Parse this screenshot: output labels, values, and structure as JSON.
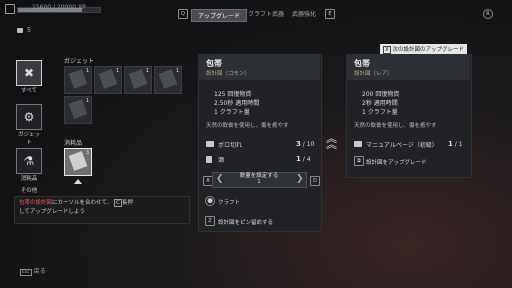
{
  "header": {
    "xp_text": "15600 / 20000 XP",
    "xp_progress": 0.78,
    "resource_count": "5",
    "tabs": [
      {
        "key": "Q",
        "label": "アップグレード"
      },
      {
        "label": "クラフト武器"
      },
      {
        "label": "武器強化"
      }
    ],
    "right_key": "E",
    "corner_btn": "R"
  },
  "nav": {
    "items": [
      {
        "label": "すべて",
        "icon": "crossed-tools-icon"
      },
      {
        "label": "ガジェット",
        "icon": "gadget-icon"
      },
      {
        "label": "消耗品",
        "icon": "bottle-icon"
      },
      {
        "label": "その他",
        "icon": "misc-icon"
      }
    ]
  },
  "inventory": {
    "gadget_title": "ガジェット",
    "gadget_slots": [
      {
        "count": "1"
      },
      {
        "count": "1"
      },
      {
        "count": "1"
      },
      {
        "count": "1"
      },
      {
        "count": "1"
      }
    ],
    "consumable_title": "消耗品",
    "consumable_slots": [
      {
        "count": "3"
      }
    ]
  },
  "tooltip": {
    "line1_red": "包帯の設計図",
    "line1_rest": "にカーソルを合わせて、",
    "key": "C",
    "line1_end": "長押",
    "line2": "してアップグレードしよう"
  },
  "back": {
    "key": "Esc",
    "label": "戻る"
  },
  "current": {
    "title": "包帯",
    "subtitle": "設計図（コモン）",
    "stats": [
      "125 回復物資",
      "2.50秒 適用時間",
      "1 クラフト量"
    ],
    "description": "天然の軟膏を使用し、傷を癒やす",
    "materials": [
      {
        "name": "ボロ切れ",
        "have": "3",
        "need": "10"
      },
      {
        "name": "酒",
        "have": "1",
        "need": "4"
      }
    ],
    "qty_label": "数量を設定する",
    "qty_value": "1",
    "qty_left_key": "A",
    "qty_right_key": "D",
    "craft_label": "クラフト",
    "pin_label": "設計図をピン留めする",
    "pin_key": "Z"
  },
  "next": {
    "tag": "次の設計図のアップグレード",
    "tag_key": "X",
    "title": "包帯",
    "subtitle": "設計図（レア）",
    "stats": [
      "200 回復物資",
      "2秒 適用時間",
      "1 クラフト量"
    ],
    "description": "天然の軟膏を使用し、傷を癒やす",
    "manual_label": "マニュアルページ（初級）",
    "manual_have": "1",
    "manual_need": "1",
    "upgrade_label": "設計図をアップグレード"
  },
  "colors": {
    "accent": "#e05a5a",
    "rarity": "#b8a67a"
  }
}
